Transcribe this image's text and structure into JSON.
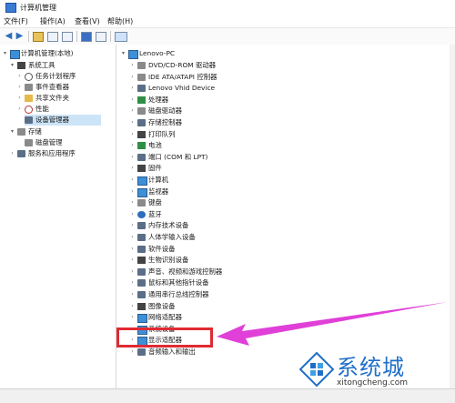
{
  "window": {
    "title": "计算机管理"
  },
  "menu": {
    "file": "文件(F)",
    "action": "操作(A)",
    "view": "查看(V)",
    "help": "帮助(H)"
  },
  "left_tree": {
    "root": "计算机管理(本地)",
    "system_tools": "系统工具",
    "task_scheduler": "任务计划程序",
    "event_viewer": "事件查看器",
    "shared_folders": "共享文件夹",
    "performance": "性能",
    "device_manager": "设备管理器",
    "storage": "存储",
    "disk_management": "磁盘管理",
    "services_apps": "服务和应用程序"
  },
  "device_tree": {
    "root": "Lenovo-PC",
    "items": [
      "DVD/CD-ROM 驱动器",
      "IDE ATA/ATAPI 控制器",
      "Lenovo Vhid Device",
      "处理器",
      "磁盘驱动器",
      "存储控制器",
      "打印队列",
      "电池",
      "端口 (COM 和 LPT)",
      "固件",
      "计算机",
      "监视器",
      "键盘",
      "蓝牙",
      "内存技术设备",
      "人体学输入设备",
      "软件设备",
      "生物识别设备",
      "声音、视频和游戏控制器",
      "鼠标和其他指针设备",
      "通用串行总线控制器",
      "图像设备",
      "网络适配器",
      "系统设备",
      "显示适配器",
      "音频输入和输出"
    ]
  },
  "watermark": {
    "brand": "系统城",
    "url": "xitongcheng.com"
  },
  "colors": {
    "highlight_box": "#e02a32",
    "arrow": "#e040d8",
    "selection": "#cce4f7"
  }
}
